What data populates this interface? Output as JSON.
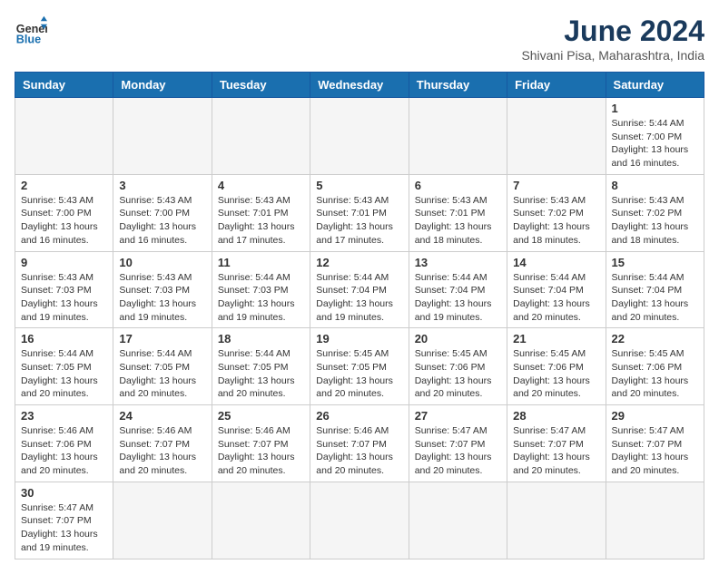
{
  "header": {
    "logo_general": "General",
    "logo_blue": "Blue",
    "month_title": "June 2024",
    "location": "Shivani Pisa, Maharashtra, India"
  },
  "days_of_week": [
    "Sunday",
    "Monday",
    "Tuesday",
    "Wednesday",
    "Thursday",
    "Friday",
    "Saturday"
  ],
  "weeks": [
    [
      {
        "day": "",
        "info": ""
      },
      {
        "day": "",
        "info": ""
      },
      {
        "day": "",
        "info": ""
      },
      {
        "day": "",
        "info": ""
      },
      {
        "day": "",
        "info": ""
      },
      {
        "day": "",
        "info": ""
      },
      {
        "day": "1",
        "info": "Sunrise: 5:44 AM\nSunset: 7:00 PM\nDaylight: 13 hours and 16 minutes."
      }
    ],
    [
      {
        "day": "2",
        "info": "Sunrise: 5:43 AM\nSunset: 7:00 PM\nDaylight: 13 hours and 16 minutes."
      },
      {
        "day": "3",
        "info": "Sunrise: 5:43 AM\nSunset: 7:00 PM\nDaylight: 13 hours and 16 minutes."
      },
      {
        "day": "4",
        "info": "Sunrise: 5:43 AM\nSunset: 7:01 PM\nDaylight: 13 hours and 17 minutes."
      },
      {
        "day": "5",
        "info": "Sunrise: 5:43 AM\nSunset: 7:01 PM\nDaylight: 13 hours and 17 minutes."
      },
      {
        "day": "6",
        "info": "Sunrise: 5:43 AM\nSunset: 7:01 PM\nDaylight: 13 hours and 18 minutes."
      },
      {
        "day": "7",
        "info": "Sunrise: 5:43 AM\nSunset: 7:02 PM\nDaylight: 13 hours and 18 minutes."
      },
      {
        "day": "8",
        "info": "Sunrise: 5:43 AM\nSunset: 7:02 PM\nDaylight: 13 hours and 18 minutes."
      }
    ],
    [
      {
        "day": "9",
        "info": "Sunrise: 5:43 AM\nSunset: 7:03 PM\nDaylight: 13 hours and 19 minutes."
      },
      {
        "day": "10",
        "info": "Sunrise: 5:43 AM\nSunset: 7:03 PM\nDaylight: 13 hours and 19 minutes."
      },
      {
        "day": "11",
        "info": "Sunrise: 5:44 AM\nSunset: 7:03 PM\nDaylight: 13 hours and 19 minutes."
      },
      {
        "day": "12",
        "info": "Sunrise: 5:44 AM\nSunset: 7:04 PM\nDaylight: 13 hours and 19 minutes."
      },
      {
        "day": "13",
        "info": "Sunrise: 5:44 AM\nSunset: 7:04 PM\nDaylight: 13 hours and 19 minutes."
      },
      {
        "day": "14",
        "info": "Sunrise: 5:44 AM\nSunset: 7:04 PM\nDaylight: 13 hours and 20 minutes."
      },
      {
        "day": "15",
        "info": "Sunrise: 5:44 AM\nSunset: 7:04 PM\nDaylight: 13 hours and 20 minutes."
      }
    ],
    [
      {
        "day": "16",
        "info": "Sunrise: 5:44 AM\nSunset: 7:05 PM\nDaylight: 13 hours and 20 minutes."
      },
      {
        "day": "17",
        "info": "Sunrise: 5:44 AM\nSunset: 7:05 PM\nDaylight: 13 hours and 20 minutes."
      },
      {
        "day": "18",
        "info": "Sunrise: 5:44 AM\nSunset: 7:05 PM\nDaylight: 13 hours and 20 minutes."
      },
      {
        "day": "19",
        "info": "Sunrise: 5:45 AM\nSunset: 7:05 PM\nDaylight: 13 hours and 20 minutes."
      },
      {
        "day": "20",
        "info": "Sunrise: 5:45 AM\nSunset: 7:06 PM\nDaylight: 13 hours and 20 minutes."
      },
      {
        "day": "21",
        "info": "Sunrise: 5:45 AM\nSunset: 7:06 PM\nDaylight: 13 hours and 20 minutes."
      },
      {
        "day": "22",
        "info": "Sunrise: 5:45 AM\nSunset: 7:06 PM\nDaylight: 13 hours and 20 minutes."
      }
    ],
    [
      {
        "day": "23",
        "info": "Sunrise: 5:46 AM\nSunset: 7:06 PM\nDaylight: 13 hours and 20 minutes."
      },
      {
        "day": "24",
        "info": "Sunrise: 5:46 AM\nSunset: 7:07 PM\nDaylight: 13 hours and 20 minutes."
      },
      {
        "day": "25",
        "info": "Sunrise: 5:46 AM\nSunset: 7:07 PM\nDaylight: 13 hours and 20 minutes."
      },
      {
        "day": "26",
        "info": "Sunrise: 5:46 AM\nSunset: 7:07 PM\nDaylight: 13 hours and 20 minutes."
      },
      {
        "day": "27",
        "info": "Sunrise: 5:47 AM\nSunset: 7:07 PM\nDaylight: 13 hours and 20 minutes."
      },
      {
        "day": "28",
        "info": "Sunrise: 5:47 AM\nSunset: 7:07 PM\nDaylight: 13 hours and 20 minutes."
      },
      {
        "day": "29",
        "info": "Sunrise: 5:47 AM\nSunset: 7:07 PM\nDaylight: 13 hours and 20 minutes."
      }
    ],
    [
      {
        "day": "30",
        "info": "Sunrise: 5:47 AM\nSunset: 7:07 PM\nDaylight: 13 hours and 19 minutes."
      },
      {
        "day": "",
        "info": ""
      },
      {
        "day": "",
        "info": ""
      },
      {
        "day": "",
        "info": ""
      },
      {
        "day": "",
        "info": ""
      },
      {
        "day": "",
        "info": ""
      },
      {
        "day": "",
        "info": ""
      }
    ]
  ]
}
